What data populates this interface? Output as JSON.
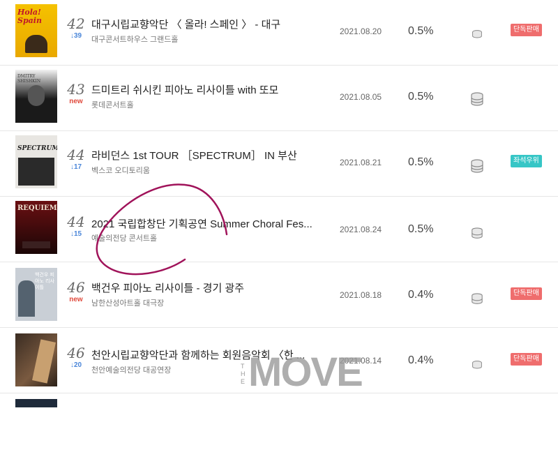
{
  "rows": [
    {
      "rank": "42",
      "change": "↓39",
      "title": "대구시립교향악단 〈 올라! 스페인 〉 - 대구",
      "venue": "대구콘서트하우스 그랜드홀",
      "date": "2021.08.20",
      "rate": "0.5%",
      "badge": "단독판매",
      "poster_text": "Hola! Spain"
    },
    {
      "rank": "43",
      "change": "new",
      "title": "드미트리 쉬시킨 피아노 리사이틀 with 또모",
      "venue": "롯데콘서트홀",
      "date": "2021.08.05",
      "rate": "0.5%",
      "badge": "",
      "poster_text": "DMITRY SHISHKIN"
    },
    {
      "rank": "44",
      "change": "↓17",
      "title": "라비던스 1st TOUR ［SPECTRUM］ IN 부산",
      "venue": "벡스코 오디토리움",
      "date": "2021.08.21",
      "rate": "0.5%",
      "badge": "좌석우위",
      "poster_text": "SPECTRUM"
    },
    {
      "rank": "44",
      "change": "↓15",
      "title": "2021 국립합창단 기획공연 Summer Choral Fes...",
      "venue": "예술의전당 콘서트홀",
      "date": "2021.08.24",
      "rate": "0.5%",
      "badge": "",
      "poster_text": "REQUIEM"
    },
    {
      "rank": "46",
      "change": "new",
      "title": "백건우 피아노 리사이틀 - 경기 광주",
      "venue": "남한산성아트홀 대극장",
      "date": "2021.08.18",
      "rate": "0.4%",
      "badge": "단독판매",
      "poster_text": "백건우 피아노 리사이틀"
    },
    {
      "rank": "46",
      "change": "↓20",
      "title": "천안시립교향악단과 함께하는 회원음악회 〈한 ...",
      "venue": "천안예술의전당 대공연장",
      "date": "2021.08.14",
      "rate": "0.4%",
      "badge": "단독판매",
      "poster_text": ""
    }
  ],
  "watermark": "MOVE",
  "watermark_side": "T H E",
  "colors": {
    "badge_red": "#ef6d6d",
    "badge_teal": "#36c6c6",
    "down": "#4a86d9",
    "new": "#e04a3c",
    "annotation": "#a0135a"
  }
}
